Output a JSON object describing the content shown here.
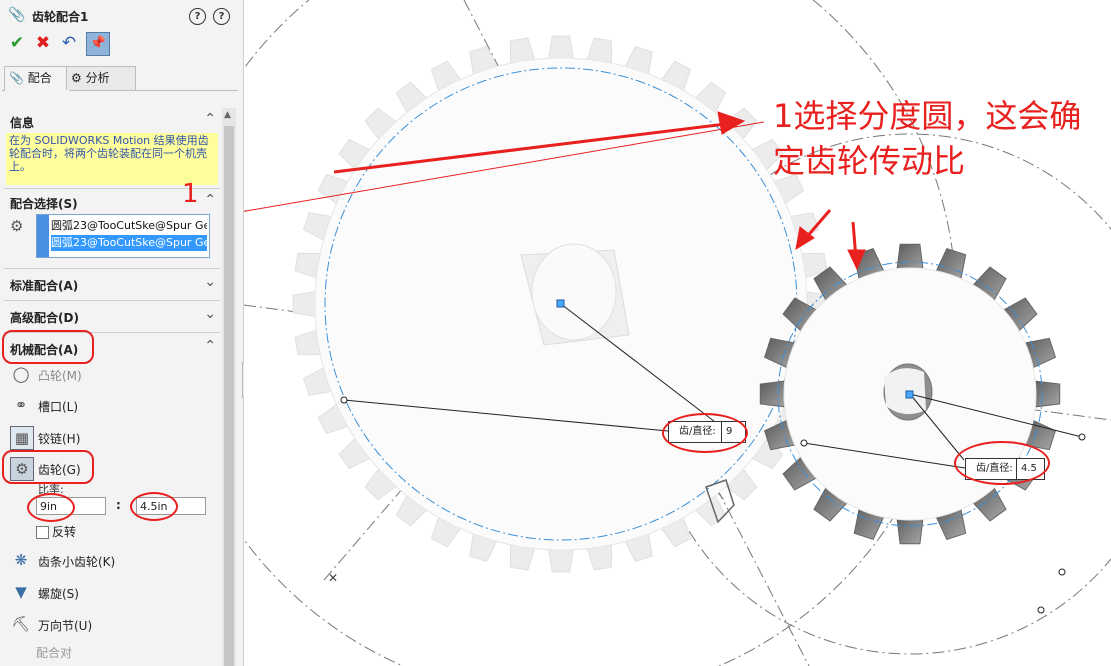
{
  "panel": {
    "title": "齿轮配合1",
    "tabs": [
      {
        "label": "配合"
      },
      {
        "label": "分析"
      }
    ],
    "sections": {
      "info": "信息",
      "mate_selection": "配合选择(S)",
      "standard": "标准配合(A)",
      "advanced": "高级配合(D)",
      "mechanical": "机械配合(A)"
    },
    "info_text": "在为 SOLIDWORKS Motion 结果使用齿轮配合时，将两个齿轮装配在同一个机壳上。",
    "selections": [
      "圆弧23@TooCutSke@Spur Ge",
      "圆弧23@TooCutSke@Spur Ge"
    ],
    "mates": [
      {
        "label": "凸轮(M)"
      },
      {
        "label": "槽口(L)"
      },
      {
        "label": "铰链(H)"
      },
      {
        "label": "齿轮(G)"
      },
      {
        "label": "齿条小齿轮(K)"
      },
      {
        "label": "螺旋(S)"
      },
      {
        "label": "万向节(U)"
      }
    ],
    "ratio_label": "比率:",
    "ratio_1": "9in",
    "ratio_2": "4.5in",
    "ratio_separator": ":",
    "reverse_label": "反转",
    "mate_pairs_label": "配合对"
  },
  "viewport": {
    "dim_label": "齿/直径:",
    "gear1_value": "9",
    "gear2_value": "4.5"
  },
  "annotations": {
    "number": "1",
    "callout": "1选择分度圆，这会确定齿轮传动比"
  },
  "colors": {
    "accent": "#e8201e",
    "selection": "#3399ff",
    "info_bg": "#fefe9d"
  }
}
